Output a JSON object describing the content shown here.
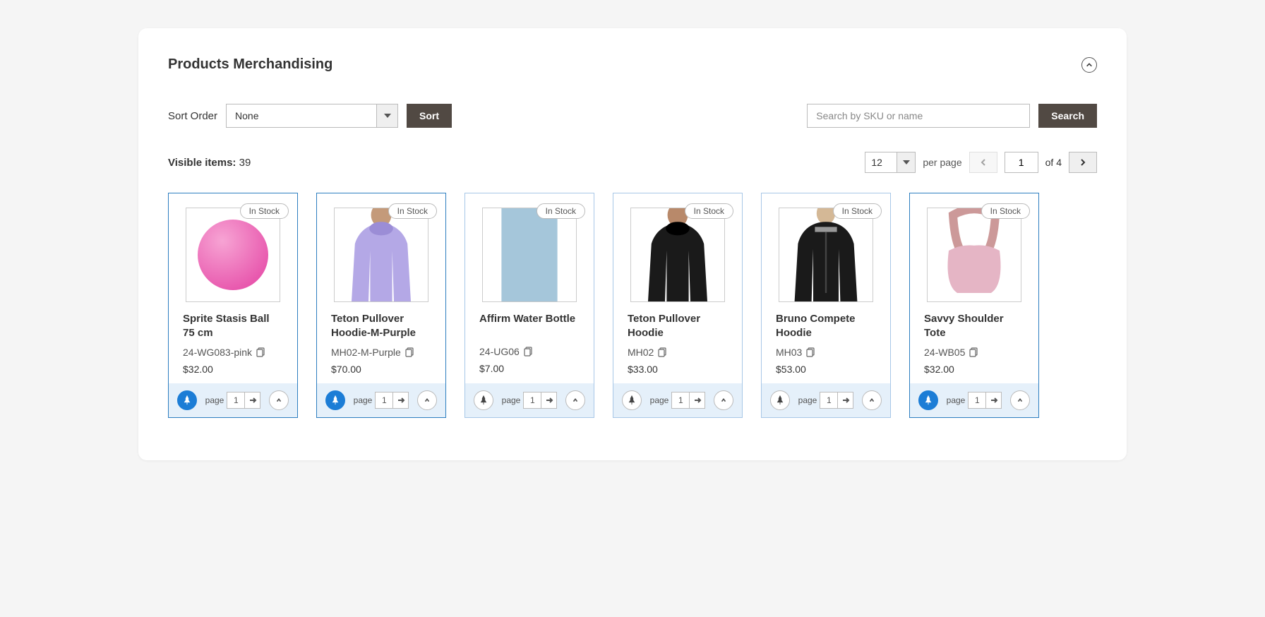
{
  "header": {
    "title": "Products Merchandising"
  },
  "toolbar": {
    "sort_label": "Sort Order",
    "sort_value": "None",
    "sort_button": "Sort",
    "search_placeholder": "Search by SKU or name",
    "search_button": "Search"
  },
  "status": {
    "visible_label": "Visible items:",
    "visible_count": "39",
    "per_page_value": "12",
    "per_page_label": "per page",
    "page_current": "1",
    "page_of_label": "of",
    "page_total": "4"
  },
  "foot": {
    "page_label": "page",
    "page_value": "1"
  },
  "products": [
    {
      "name": "Sprite Stasis Ball 75 cm",
      "sku": "24-WG083-pink",
      "price": "$32.00",
      "stock": "In Stock",
      "pinned": true,
      "image": "ball"
    },
    {
      "name": "Teton Pullover Hoodie-M-Purple",
      "sku": "MH02-M-Purple",
      "price": "$70.00",
      "stock": "In Stock",
      "pinned": true,
      "image": "hoodie-purple"
    },
    {
      "name": "Affirm Water Bottle",
      "sku": "24-UG06",
      "price": "$7.00",
      "stock": "In Stock",
      "pinned": false,
      "image": "bottle"
    },
    {
      "name": "Teton Pullover Hoodie",
      "sku": "MH02",
      "price": "$33.00",
      "stock": "In Stock",
      "pinned": false,
      "image": "hoodie-black"
    },
    {
      "name": "Bruno Compete Hoodie",
      "sku": "MH03",
      "price": "$53.00",
      "stock": "In Stock",
      "pinned": false,
      "image": "hoodie-black2"
    },
    {
      "name": "Savvy Shoulder Tote",
      "sku": "24-WB05",
      "price": "$32.00",
      "stock": "In Stock",
      "pinned": true,
      "image": "tote"
    }
  ]
}
